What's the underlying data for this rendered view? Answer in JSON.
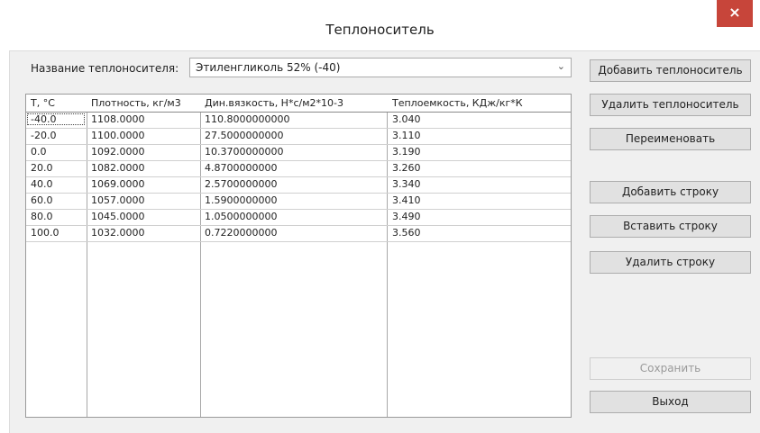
{
  "window": {
    "title": "Теплоноситель",
    "close_glyph": "×"
  },
  "form": {
    "name_label": "Название теплоносителя:",
    "selected": "Этиленгликоль 52% (-40)",
    "dropdown_glyph": "⌄"
  },
  "table": {
    "headers": [
      "T, °C",
      "Плотность, кг/м3",
      "Дин.вязкость, Н*с/м2*10-3",
      "Теплоемкость, КДж/кг*К"
    ],
    "rows": [
      [
        "-40.0",
        "1108.0000",
        "110.8000000000",
        "3.040"
      ],
      [
        "-20.0",
        "1100.0000",
        "27.5000000000",
        "3.110"
      ],
      [
        "0.0",
        "1092.0000",
        "10.3700000000",
        "3.190"
      ],
      [
        "20.0",
        "1082.0000",
        "4.8700000000",
        "3.260"
      ],
      [
        "40.0",
        "1069.0000",
        "2.5700000000",
        "3.340"
      ],
      [
        "60.0",
        "1057.0000",
        "1.5900000000",
        "3.410"
      ],
      [
        "80.0",
        "1045.0000",
        "1.0500000000",
        "3.490"
      ],
      [
        "100.0",
        "1032.0000",
        "0.7220000000",
        "3.560"
      ]
    ]
  },
  "buttons": {
    "add_coolant": "Добавить теплоноситель",
    "delete_coolant": "Удалить теплоноситель",
    "rename": "Переименовать",
    "add_row": "Добавить строку",
    "insert_row": "Вставить строку",
    "delete_row": "Удалить строку",
    "save": "Сохранить",
    "exit": "Выход"
  },
  "colors": {
    "close_button": "#c7453a",
    "panel": "#f0f0f0",
    "button": "#e1e1e1"
  }
}
